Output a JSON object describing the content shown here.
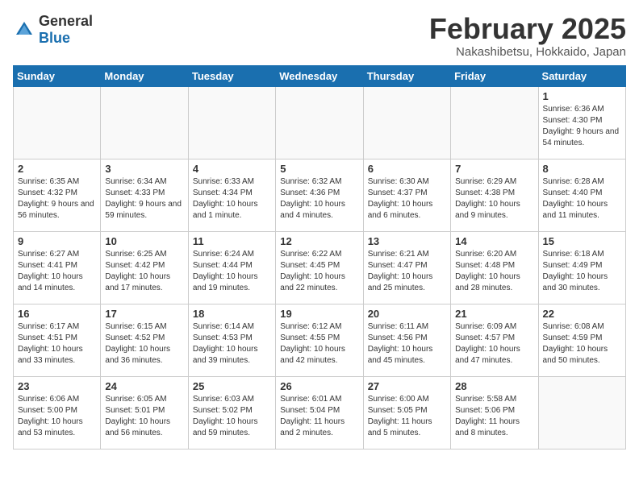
{
  "logo": {
    "general": "General",
    "blue": "Blue"
  },
  "title": {
    "month": "February 2025",
    "location": "Nakashibetsu, Hokkaido, Japan"
  },
  "weekdays": [
    "Sunday",
    "Monday",
    "Tuesday",
    "Wednesday",
    "Thursday",
    "Friday",
    "Saturday"
  ],
  "weeks": [
    [
      {
        "day": "",
        "info": ""
      },
      {
        "day": "",
        "info": ""
      },
      {
        "day": "",
        "info": ""
      },
      {
        "day": "",
        "info": ""
      },
      {
        "day": "",
        "info": ""
      },
      {
        "day": "",
        "info": ""
      },
      {
        "day": "1",
        "info": "Sunrise: 6:36 AM\nSunset: 4:30 PM\nDaylight: 9 hours and 54 minutes."
      }
    ],
    [
      {
        "day": "2",
        "info": "Sunrise: 6:35 AM\nSunset: 4:32 PM\nDaylight: 9 hours and 56 minutes."
      },
      {
        "day": "3",
        "info": "Sunrise: 6:34 AM\nSunset: 4:33 PM\nDaylight: 9 hours and 59 minutes."
      },
      {
        "day": "4",
        "info": "Sunrise: 6:33 AM\nSunset: 4:34 PM\nDaylight: 10 hours and 1 minute."
      },
      {
        "day": "5",
        "info": "Sunrise: 6:32 AM\nSunset: 4:36 PM\nDaylight: 10 hours and 4 minutes."
      },
      {
        "day": "6",
        "info": "Sunrise: 6:30 AM\nSunset: 4:37 PM\nDaylight: 10 hours and 6 minutes."
      },
      {
        "day": "7",
        "info": "Sunrise: 6:29 AM\nSunset: 4:38 PM\nDaylight: 10 hours and 9 minutes."
      },
      {
        "day": "8",
        "info": "Sunrise: 6:28 AM\nSunset: 4:40 PM\nDaylight: 10 hours and 11 minutes."
      }
    ],
    [
      {
        "day": "9",
        "info": "Sunrise: 6:27 AM\nSunset: 4:41 PM\nDaylight: 10 hours and 14 minutes."
      },
      {
        "day": "10",
        "info": "Sunrise: 6:25 AM\nSunset: 4:42 PM\nDaylight: 10 hours and 17 minutes."
      },
      {
        "day": "11",
        "info": "Sunrise: 6:24 AM\nSunset: 4:44 PM\nDaylight: 10 hours and 19 minutes."
      },
      {
        "day": "12",
        "info": "Sunrise: 6:22 AM\nSunset: 4:45 PM\nDaylight: 10 hours and 22 minutes."
      },
      {
        "day": "13",
        "info": "Sunrise: 6:21 AM\nSunset: 4:47 PM\nDaylight: 10 hours and 25 minutes."
      },
      {
        "day": "14",
        "info": "Sunrise: 6:20 AM\nSunset: 4:48 PM\nDaylight: 10 hours and 28 minutes."
      },
      {
        "day": "15",
        "info": "Sunrise: 6:18 AM\nSunset: 4:49 PM\nDaylight: 10 hours and 30 minutes."
      }
    ],
    [
      {
        "day": "16",
        "info": "Sunrise: 6:17 AM\nSunset: 4:51 PM\nDaylight: 10 hours and 33 minutes."
      },
      {
        "day": "17",
        "info": "Sunrise: 6:15 AM\nSunset: 4:52 PM\nDaylight: 10 hours and 36 minutes."
      },
      {
        "day": "18",
        "info": "Sunrise: 6:14 AM\nSunset: 4:53 PM\nDaylight: 10 hours and 39 minutes."
      },
      {
        "day": "19",
        "info": "Sunrise: 6:12 AM\nSunset: 4:55 PM\nDaylight: 10 hours and 42 minutes."
      },
      {
        "day": "20",
        "info": "Sunrise: 6:11 AM\nSunset: 4:56 PM\nDaylight: 10 hours and 45 minutes."
      },
      {
        "day": "21",
        "info": "Sunrise: 6:09 AM\nSunset: 4:57 PM\nDaylight: 10 hours and 47 minutes."
      },
      {
        "day": "22",
        "info": "Sunrise: 6:08 AM\nSunset: 4:59 PM\nDaylight: 10 hours and 50 minutes."
      }
    ],
    [
      {
        "day": "23",
        "info": "Sunrise: 6:06 AM\nSunset: 5:00 PM\nDaylight: 10 hours and 53 minutes."
      },
      {
        "day": "24",
        "info": "Sunrise: 6:05 AM\nSunset: 5:01 PM\nDaylight: 10 hours and 56 minutes."
      },
      {
        "day": "25",
        "info": "Sunrise: 6:03 AM\nSunset: 5:02 PM\nDaylight: 10 hours and 59 minutes."
      },
      {
        "day": "26",
        "info": "Sunrise: 6:01 AM\nSunset: 5:04 PM\nDaylight: 11 hours and 2 minutes."
      },
      {
        "day": "27",
        "info": "Sunrise: 6:00 AM\nSunset: 5:05 PM\nDaylight: 11 hours and 5 minutes."
      },
      {
        "day": "28",
        "info": "Sunrise: 5:58 AM\nSunset: 5:06 PM\nDaylight: 11 hours and 8 minutes."
      },
      {
        "day": "",
        "info": ""
      }
    ]
  ]
}
